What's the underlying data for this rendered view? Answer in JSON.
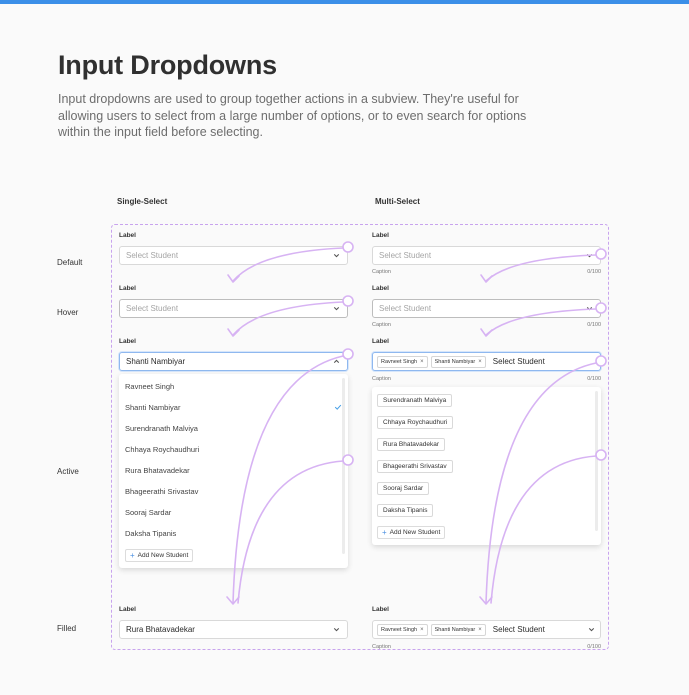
{
  "header": {
    "title": "Input Dropdowns",
    "description": "Input dropdowns are used to group together actions in a subview. They're useful for allowing users to select from a large number of options, or to even search for options within the input field before selecting."
  },
  "columns": {
    "single": "Single-Select",
    "multi": "Multi-Select"
  },
  "rows": {
    "default": "Default",
    "hover": "Hover",
    "active": "Active",
    "filled": "Filled"
  },
  "field": {
    "label": "Label",
    "placeholder": "Select Student",
    "caption": "Caption",
    "counter": "0/100"
  },
  "single": {
    "active_value": "Shanti Nambiyar",
    "filled_value": "Rura Bhatavadekar",
    "options": [
      "Ravneet Singh",
      "Shanti Nambiyar",
      "Surendranath Malviya",
      "Chhaya Roychaudhuri",
      "Rura Bhatavadekar",
      "Bhageerathi Srivastav",
      "Sooraj Sardar",
      "Daksha Tipanis"
    ],
    "selected_option": "Shanti Nambiyar",
    "add_label": "Add New Student"
  },
  "multi": {
    "tags": [
      "Ravneet Singh",
      "Shanti Nambiyar"
    ],
    "input_text": "Select Student",
    "options": [
      "Surendranath Malviya",
      "Chhaya Roychaudhuri",
      "Rura Bhatavadekar",
      "Bhageerathi Srivastav",
      "Sooraj Sardar",
      "Daksha Tipanis"
    ],
    "add_label": "Add New Student"
  },
  "colors": {
    "accent": "#3b8fe8",
    "frame": "#c8a3ee",
    "arrow": "#d7b3f3",
    "check": "#4aa1e6"
  }
}
